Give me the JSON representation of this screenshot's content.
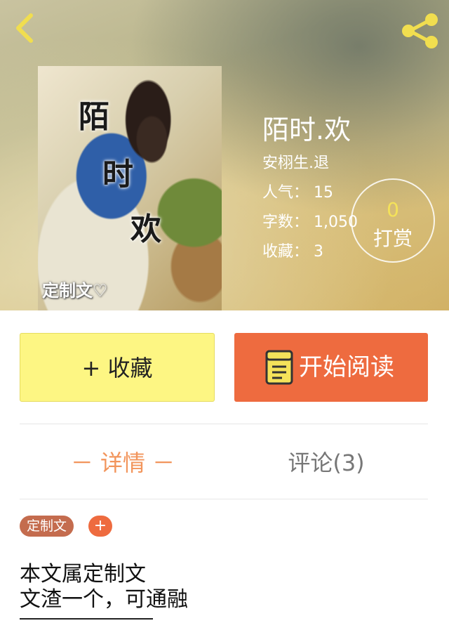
{
  "header": {
    "back_icon": "chevron-left-icon",
    "share_icon": "share-icon"
  },
  "cover": {
    "title_chars": [
      "陌",
      "时",
      "欢"
    ],
    "tag": "定制文♡"
  },
  "book": {
    "title": "陌时.欢",
    "author": "安栩生.退",
    "popularity": "人气：  15",
    "word_count": "字数：  1,050",
    "favorites": "收藏：  3"
  },
  "tip": {
    "count": "0",
    "label": "打赏"
  },
  "actions": {
    "collect_label": "+ 收藏",
    "read_label": "开始阅读"
  },
  "tabs": [
    {
      "label": "－ 详情 －",
      "active": true
    },
    {
      "label": "评论(3)",
      "active": false
    }
  ],
  "tags": {
    "items": [
      "定制文"
    ],
    "add_label": "+"
  },
  "description": {
    "lines": [
      "本文属定制文",
      "文渣一个，可通融"
    ]
  },
  "colors": {
    "accent_orange": "#ee6b3f",
    "collect_yellow": "#fdf683",
    "active_tab": "#f2955c",
    "tip_count": "#f4e25a",
    "tag_pill": "#c46c4e"
  }
}
